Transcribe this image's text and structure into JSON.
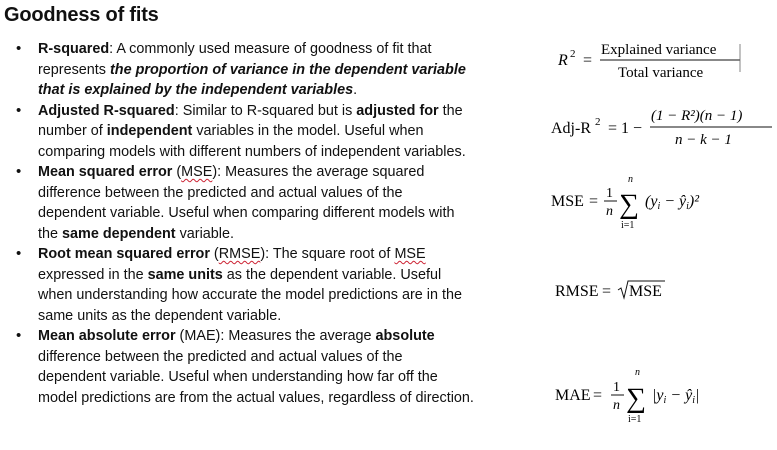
{
  "title": "Goodness of fits",
  "bullets": [
    {
      "name": "r-squared",
      "term": "R-squared",
      "sep": ": ",
      "text1": "A commonly used measure of goodness of fit that represents ",
      "emph": "the proportion of variance in the dependent variable that is explained by the independent variables",
      "text2": "."
    },
    {
      "name": "adjusted-r-squared",
      "term": "Adjusted R-squared",
      "sep": ": ",
      "text1": "Similar to R-squared but is ",
      "bold1": "adjusted for",
      "text2": " the number of ",
      "bold2": "independent",
      "text3": " variables in the model. Useful when comparing models with different numbers of independent variables."
    },
    {
      "name": "mse",
      "term": "Mean squared error",
      "open": " (",
      "abbr": "MSE",
      "close": "): ",
      "text1": "Measures the average squared difference between the predicted and actual values of the dependent variable. Useful when comparing different models with the ",
      "bold1": "same dependent",
      "text2": " variable."
    },
    {
      "name": "rmse",
      "term": "Root mean squared error",
      "open": " (",
      "abbr": "RMSE",
      "close": "): ",
      "text1": "The square root of ",
      "abbr2": "MSE",
      "text2": " expressed in the ",
      "bold1": "same units",
      "text3": " as the dependent variable. Useful when understanding how accurate the model predictions are in the same units as the dependent variable."
    },
    {
      "name": "mae",
      "term": "Mean absolute error",
      "text1": " (MAE): Measures the average ",
      "bold1": "absolute",
      "text2": " difference between the predicted and actual values of the dependent variable. Useful when understanding how far off the model predictions are from the actual values, regardless of direction."
    }
  ],
  "formulas": {
    "r2": {
      "lhs": "R",
      "sup": "2",
      "eq": "=",
      "num": "Explained variance",
      "den": "Total variance"
    },
    "adj": {
      "lhs": "Adj-R",
      "sup": "2",
      "eq": "= 1 −",
      "num": "(1 − R²)(n − 1)",
      "den": "n − k − 1"
    },
    "mse": {
      "lhs": "MSE",
      "eq": "=",
      "one": "1",
      "n": "n",
      "top": "n",
      "bottom": "i=1",
      "body": "(y",
      "sub": "i",
      "mid": " − ŷ",
      "sub2": "i",
      "end": ")²"
    },
    "rmse": {
      "lhs": "RMSE",
      "eq": "=",
      "arg": "MSE"
    },
    "mae": {
      "lhs": "MAE",
      "eq": "=",
      "one": "1",
      "n": "n",
      "top": "n",
      "bottom": "i=1",
      "body": "|y",
      "sub": "i",
      "mid": " − ŷ",
      "sub2": "i",
      "end": "|"
    }
  }
}
